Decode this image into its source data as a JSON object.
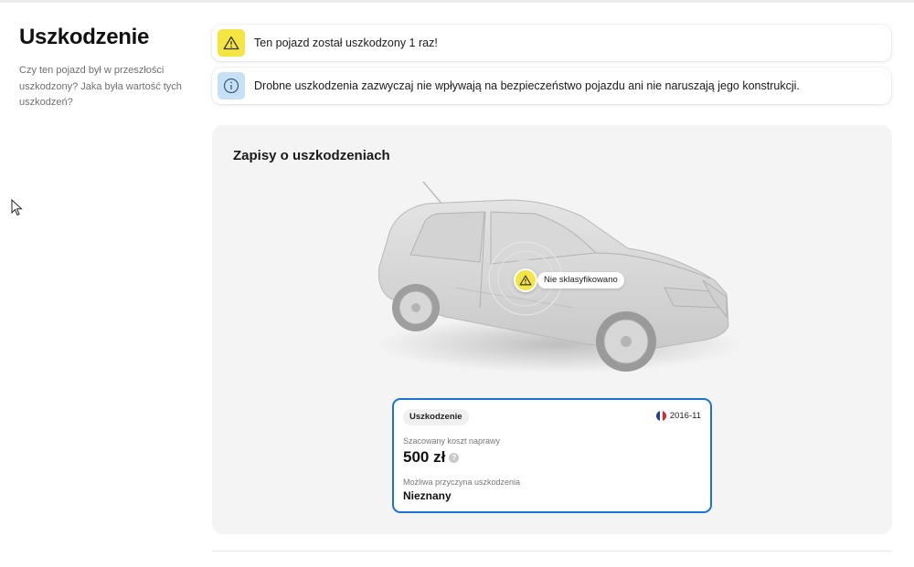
{
  "section": {
    "title": "Uszkodzenie",
    "description": "Czy ten pojazd był w przeszłości uszkodzony? Jaka była wartość tych uszkodzeń?"
  },
  "alerts": [
    {
      "icon": "warning-icon",
      "text": "Ten pojazd został uszkodzony 1 raz!"
    },
    {
      "icon": "info-icon",
      "text": "Drobne uszkodzenia zazwyczaj nie wpływają na bezpieczeństwo pojazdu ani nie naruszają jego konstrukcji."
    }
  ],
  "records": {
    "title": "Zapisy o uszkodzeniach",
    "marker_label": "Nie sklasyfikowano",
    "card": {
      "chip": "Uszkodzenie",
      "date": "2016-11",
      "country_flag": "france-flag-icon",
      "cost_label": "Szacowany koszt naprawy",
      "cost_value": "500 zł",
      "cost_help": "?",
      "cause_label": "Możliwa przyczyna uszkodzenia",
      "cause_value": "Nieznany"
    }
  },
  "colors": {
    "warning": "#f5e543",
    "info": "#c6e1f5",
    "card_border": "#1a73d9",
    "panel_bg": "#f4f4f4"
  }
}
